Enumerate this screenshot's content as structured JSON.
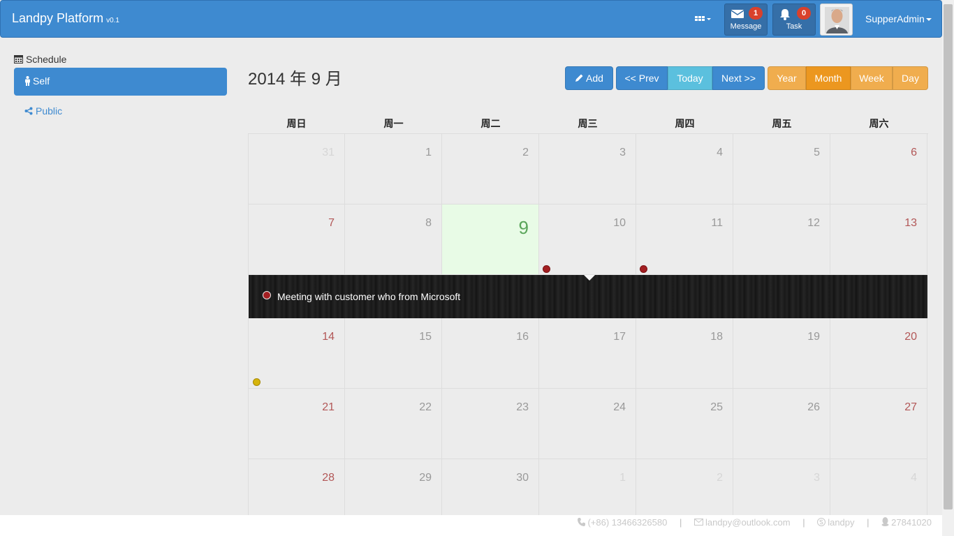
{
  "navbar": {
    "brand": "Landpy Platform",
    "version": "v0.1",
    "message": {
      "label": "Message",
      "count": "1"
    },
    "task": {
      "label": "Task",
      "count": "0"
    },
    "user": "SupperAdmin"
  },
  "sidebar": {
    "title": "Schedule",
    "items": [
      {
        "label": "Self",
        "active": true
      },
      {
        "label": "Public",
        "active": false
      }
    ]
  },
  "calendar": {
    "title": "2014 年 9 月",
    "buttons": {
      "add": "Add",
      "prev": "<< Prev",
      "today": "Today",
      "next": "Next >>",
      "year": "Year",
      "month": "Month",
      "week": "Week",
      "day": "Day"
    },
    "active_view": "Month",
    "weekdays": [
      "周日",
      "周一",
      "周二",
      "周三",
      "周四",
      "周五",
      "周六"
    ],
    "weeks": [
      [
        "31",
        "1",
        "2",
        "3",
        "4",
        "5",
        "6"
      ],
      [
        "7",
        "8",
        "9",
        "10",
        "11",
        "12",
        "13"
      ],
      [
        "14",
        "15",
        "16",
        "17",
        "18",
        "19",
        "20"
      ],
      [
        "21",
        "22",
        "23",
        "24",
        "25",
        "26",
        "27"
      ],
      [
        "28",
        "29",
        "30",
        "1",
        "2",
        "3",
        "4"
      ]
    ],
    "today": "9",
    "event_dots": [
      {
        "day": "10",
        "color": "#a31f22"
      },
      {
        "day": "11",
        "color": "#a31f22"
      },
      {
        "day": "14",
        "color": "#d6b40c"
      }
    ],
    "event_strip": {
      "text": "Meeting with customer who from Microsoft",
      "color": "#a31f22"
    }
  },
  "footer": {
    "phone": "(+86) 13466326580",
    "email": "landpy@outlook.com",
    "skype": "landpy",
    "qq": "27841020"
  },
  "colors": {
    "primary": "#3e8ad0",
    "info": "#5bc0de",
    "warning": "#f0ad4e",
    "weekend": "#b25757",
    "today_bg": "#e8fbe6"
  }
}
